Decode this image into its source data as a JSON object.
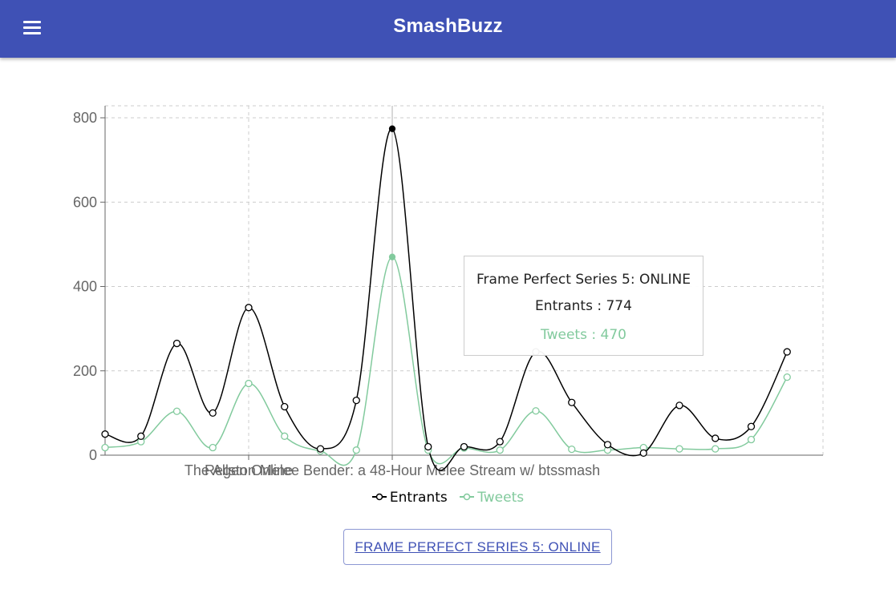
{
  "app": {
    "title": "SmashBuzz"
  },
  "legend": {
    "entrants": "Entrants",
    "tweets": "Tweets"
  },
  "tooltip": {
    "title": "Frame Perfect Series 5: ONLINE",
    "entrants_label": "Entrants",
    "entrants_value": 774,
    "tweets_label": "Tweets",
    "tweets_value": 470
  },
  "selected_event_button": "FRAME PERFECT SERIES 5: ONLINE",
  "colors": {
    "appbar": "#3f51b5",
    "entrants": "#000000",
    "tweets": "#82ca9d",
    "grid": "#cccccc"
  },
  "chart_data": {
    "type": "line",
    "x": [
      "",
      "",
      "",
      "",
      "Regen Online",
      "",
      "",
      "",
      "The Allston Melee Bender: a 48-Hour Melee Stream w/ btssmash",
      "",
      "",
      "",
      "",
      "",
      "",
      "",
      "",
      "",
      "",
      "",
      ""
    ],
    "visible_x_ticks": [
      "Regen Online",
      "The Allston Melee Bender: a 48-Hour Melee Stream w/ btssmash"
    ],
    "series": [
      {
        "name": "Entrants",
        "values": [
          50,
          45,
          265,
          100,
          350,
          115,
          15,
          130,
          774,
          20,
          20,
          32,
          245,
          125,
          25,
          5,
          118,
          40,
          68,
          245
        ]
      },
      {
        "name": "Tweets",
        "values": [
          18,
          32,
          104,
          18,
          170,
          45,
          10,
          12,
          470,
          12,
          17,
          12,
          105,
          14,
          12,
          18,
          15,
          15,
          37,
          185
        ]
      }
    ],
    "y_ticks": [
      0,
      200,
      400,
      600,
      800
    ],
    "ylim": [
      0,
      800
    ],
    "active_index": 8,
    "grid": true,
    "legend_position": "bottom"
  }
}
